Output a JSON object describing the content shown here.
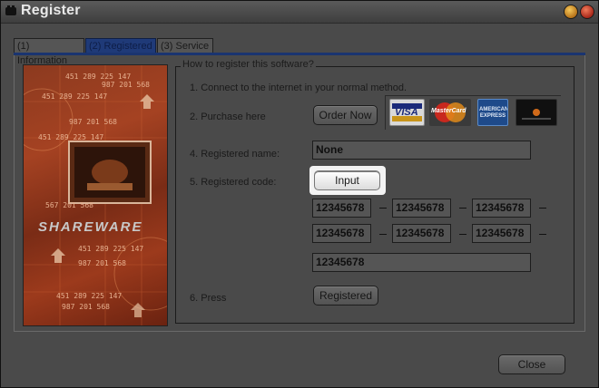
{
  "window": {
    "title": "Register"
  },
  "tabs": [
    {
      "label": "(1) Information",
      "active": false
    },
    {
      "label": "(2) Registered",
      "active": true
    },
    {
      "label": "(3) Service",
      "active": false
    }
  ],
  "banner": {
    "logo_text": "SHAREWARE",
    "numbers": [
      "451 289 225 147",
      "987 201 568",
      "451 289 225 147",
      "987 201 568",
      "451 289 225 147",
      "567 201 568",
      "451 289 225 147",
      "987 201 568",
      "451 289 225 147",
      "987 201 568"
    ]
  },
  "group": {
    "legend": "How to register this software?",
    "step1": "1. Connect to the internet in your normal method.",
    "step2": "2. Purchase here",
    "order_button": "Order Now",
    "cards": [
      "visa-card-icon",
      "mastercard-icon",
      "american-express-icon",
      "discover-card-icon"
    ],
    "card_labels": {
      "visa": "VISA",
      "mastercard": "MasterCard",
      "amex": "AMERICAN EXPRESS"
    },
    "step4": "4. Registered name:",
    "registered_name": "None",
    "step5": "5. Registered code:",
    "input_button": "Input",
    "codes": [
      "12345678",
      "12345678",
      "12345678",
      "12345678",
      "12345678",
      "12345678",
      "12345678"
    ],
    "step6": "6. Press",
    "registered_button": "Registered"
  },
  "footer": {
    "close_button": "Close"
  },
  "colors": {
    "window_bg": "#4a4a4a",
    "active_tab": "#1f3a78",
    "banner": "#a54222"
  }
}
